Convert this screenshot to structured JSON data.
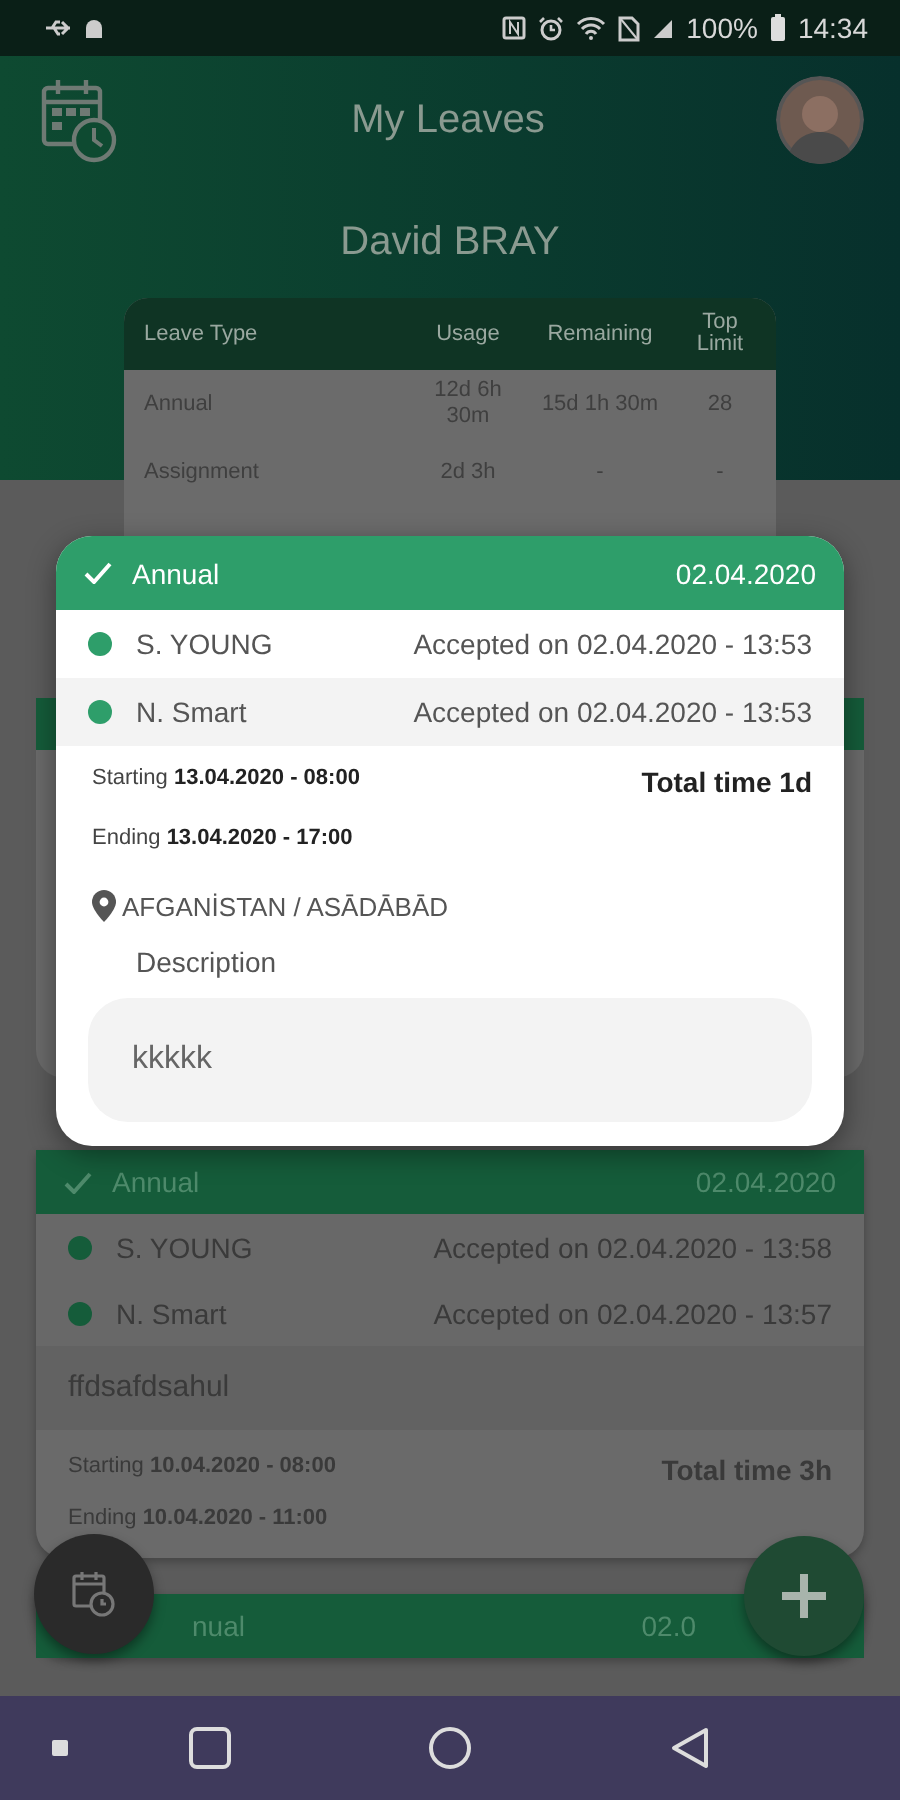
{
  "status_bar": {
    "battery": "100%",
    "time": "14:34"
  },
  "app_bar": {
    "title": "My Leaves"
  },
  "user": {
    "name": "David BRAY"
  },
  "balance_table": {
    "columns": [
      "Leave Type",
      "Usage",
      "Remaining",
      "Top Limit"
    ],
    "rows": [
      [
        "Annual",
        "12d 6h 30m",
        "15d 1h 30m",
        "28"
      ],
      [
        "Assignment",
        "2d 3h",
        "-",
        "-"
      ]
    ]
  },
  "leave_cards": [
    {
      "type": "Annual",
      "date": "02.04.2020",
      "approvals": [
        {
          "name": "S. YOUNG",
          "status": "Accepted on 02.04.2020 - 13:58"
        },
        {
          "name": "N. Smart",
          "status": "Accepted on 02.04.2020 - 13:57"
        }
      ],
      "description": "ffdsafdsahul",
      "starting": "Starting **10.04.2020 - 08:00**",
      "ending": "Ending **10.04.2020 - 11:00**",
      "total_time": "Total time 3h"
    },
    {
      "type": "nual",
      "date": "02.0"
    }
  ],
  "leave_detail": {
    "type": "Annual",
    "date": "02.04.2020",
    "approvals": [
      {
        "name": "S. YOUNG",
        "status": "Accepted on 02.04.2020 - 13:53"
      },
      {
        "name": "N. Smart",
        "status": "Accepted on 02.04.2020 - 13:53"
      }
    ],
    "starting": "Starting **13.04.2020 - 08:00**",
    "ending": "Ending **13.04.2020 - 17:00**",
    "total_time": "Total time 1d",
    "location": "AFGANİSTAN / ASĀDĀBĀD",
    "description_label": "Description",
    "description": "kkkkk"
  }
}
